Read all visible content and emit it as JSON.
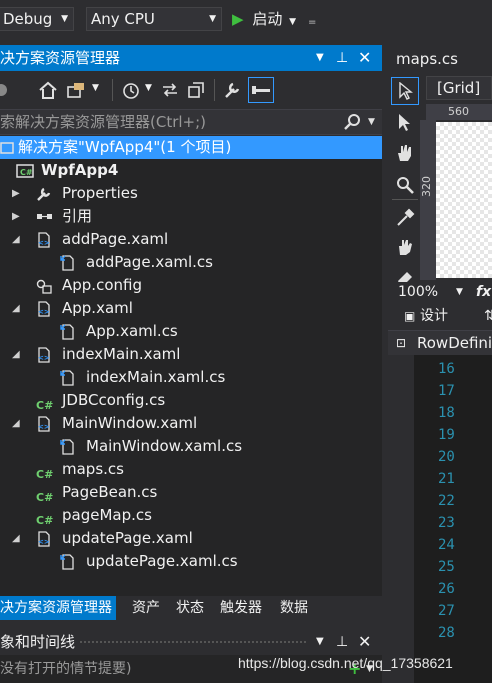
{
  "toolbar": {
    "config": "Debug",
    "platform": "Any CPU",
    "start_label": "启动"
  },
  "solution_explorer": {
    "title": "决方案资源管理器",
    "search_placeholder": "索解决方案资源管理器(Ctrl+;)",
    "items": [
      {
        "label": "解决方案\"WpfApp4\"(1 个项目)",
        "icon": "solution-icon",
        "selected": true
      },
      {
        "label": "WpfApp4",
        "icon": "project-icon",
        "bold": true
      },
      {
        "label": "Properties",
        "icon": "wrench-icon"
      },
      {
        "label": "引用",
        "icon": "references-icon"
      },
      {
        "label": "addPage.xaml",
        "icon": "xaml-file-icon"
      },
      {
        "label": "addPage.xaml.cs",
        "icon": "code-file-icon"
      },
      {
        "label": "App.config",
        "icon": "config-file-icon"
      },
      {
        "label": "App.xaml",
        "icon": "xaml-file-icon"
      },
      {
        "label": "App.xaml.cs",
        "icon": "code-file-icon"
      },
      {
        "label": "indexMain.xaml",
        "icon": "xaml-file-icon"
      },
      {
        "label": "indexMain.xaml.cs",
        "icon": "code-file-icon"
      },
      {
        "label": "JDBCconfig.cs",
        "icon": "csharp-file-icon"
      },
      {
        "label": "MainWindow.xaml",
        "icon": "xaml-file-icon"
      },
      {
        "label": "MainWindow.xaml.cs",
        "icon": "code-file-icon"
      },
      {
        "label": "maps.cs",
        "icon": "csharp-file-icon"
      },
      {
        "label": "PageBean.cs",
        "icon": "csharp-file-icon"
      },
      {
        "label": "pageMap.cs",
        "icon": "csharp-file-icon"
      },
      {
        "label": "updatePage.xaml",
        "icon": "xaml-file-icon"
      },
      {
        "label": "updatePage.xaml.cs",
        "icon": "code-file-icon"
      }
    ],
    "bottom_tabs": [
      "决方案资源管理器",
      "资产",
      "状态",
      "触发器",
      "数据"
    ]
  },
  "timeline_panel": {
    "title": "象和时间线",
    "body_text": "没有打开的情节提要)"
  },
  "designer": {
    "doc_tab": "maps.cs",
    "grid_selector": "[Grid]",
    "ruler_top": "560",
    "ruler_left": "320",
    "zoom": "100%",
    "fx_label": "fx",
    "design_tab": "设计",
    "breadcrumb": "RowDefini",
    "line_numbers": [
      "16",
      "17",
      "18",
      "19",
      "20",
      "21",
      "22",
      "23",
      "24",
      "25",
      "26",
      "27",
      "28"
    ]
  },
  "watermark": "https://blog.csdn.net/qq_17358621",
  "colors": {
    "accent": "#007acc",
    "selection": "#3399ff",
    "play": "#3fbf3f"
  }
}
